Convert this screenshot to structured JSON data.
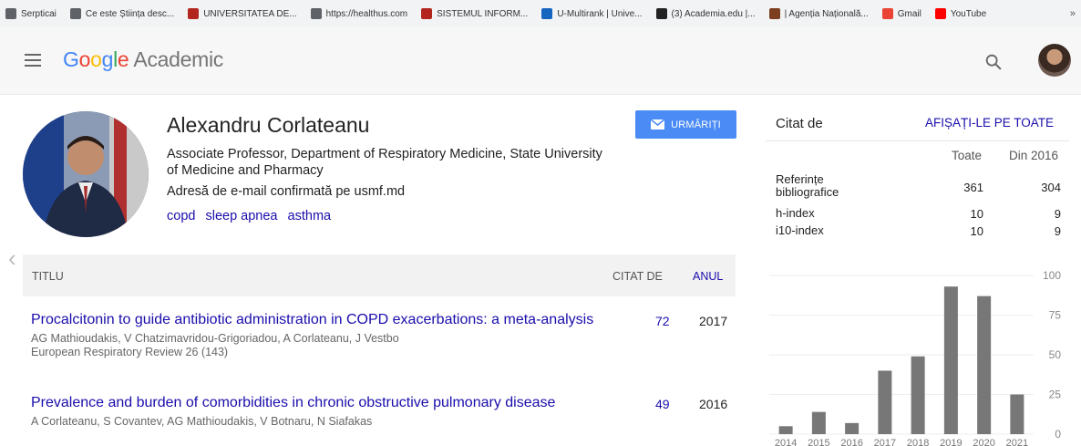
{
  "bookmarks": [
    {
      "label": "Serpticai",
      "icon": "apps-grid-icon",
      "color": "#5f6368"
    },
    {
      "label": "Ce este Știința desc...",
      "icon": "globe-icon",
      "color": "#5f6368"
    },
    {
      "label": "UNIVERSITATEA DE...",
      "icon": "bookmark-icon",
      "color": "#b3261e"
    },
    {
      "label": "https://healthus.com",
      "icon": "globe-icon",
      "color": "#5f6368"
    },
    {
      "label": "SISTEMUL INFORM...",
      "icon": "bookmark-icon",
      "color": "#b3261e"
    },
    {
      "label": "U-Multirank | Unive...",
      "icon": "u-logo-icon",
      "color": "#1565c0"
    },
    {
      "label": "(3) Academia.edu |...",
      "icon": "academia-a-icon",
      "color": "#222222"
    },
    {
      "label": "| Agenția Națională...",
      "icon": "emblem-icon",
      "color": "#7b3f1f"
    },
    {
      "label": "Gmail",
      "icon": "gmail-icon",
      "color": "#ea4335"
    },
    {
      "label": "YouTube",
      "icon": "youtube-icon",
      "color": "#ff0000"
    }
  ],
  "bookmarks_more": "»",
  "header": {
    "logo_letters": [
      "G",
      "o",
      "o",
      "g",
      "l",
      "e"
    ],
    "logo_suffix": "Academic"
  },
  "profile": {
    "name": "Alexandru Corlateanu",
    "affiliation": "Associate Professor, Department of Respiratory Medicine, State University of Medicine and Pharmacy",
    "email_verified": "Adresă de e-mail confirmată pe usmf.md",
    "interests": [
      "copd",
      "sleep apnea",
      "asthma"
    ],
    "follow_label": "URMĂRIȚI"
  },
  "prev_chevron": "‹",
  "table": {
    "col_title": "TITLU",
    "col_cited": "CITAT DE",
    "col_year": "ANUL",
    "articles": [
      {
        "title": "Procalcitonin to guide antibiotic administration in COPD exacerbations: a meta-analysis",
        "authors": "AG Mathioudakis, V Chatzimavridou-Grigoriadou, A Corlateanu, J Vestbo",
        "venue": "European Respiratory Review 26 (143)",
        "cited": "72",
        "year": "2017"
      },
      {
        "title": "Prevalence and burden of comorbidities in chronic obstructive pulmonary disease",
        "authors": "A Corlateanu, S Covantev, AG Mathioudakis, V Botnaru, N Siafakas",
        "venue": "",
        "cited": "49",
        "year": "2016"
      }
    ]
  },
  "cited_by": {
    "title": "Citat de",
    "show_all": "AFIȘAȚI-LE PE TOATE",
    "col_all": "Toate",
    "col_since": "Din 2016",
    "rows": [
      {
        "label": "Referințe bibliografice",
        "all": "361",
        "since": "304"
      },
      {
        "label": "h-index",
        "all": "10",
        "since": "9"
      },
      {
        "label": "i10-index",
        "all": "10",
        "since": "9"
      }
    ]
  },
  "chart_data": {
    "type": "bar",
    "categories": [
      "2014",
      "2015",
      "2016",
      "2017",
      "2018",
      "2019",
      "2020",
      "2021"
    ],
    "values": [
      5,
      14,
      7,
      40,
      49,
      93,
      87,
      25
    ],
    "ylim": [
      0,
      100
    ],
    "yticks": [
      "100",
      "75",
      "50",
      "25",
      "0"
    ],
    "bar_color": "#777777"
  }
}
